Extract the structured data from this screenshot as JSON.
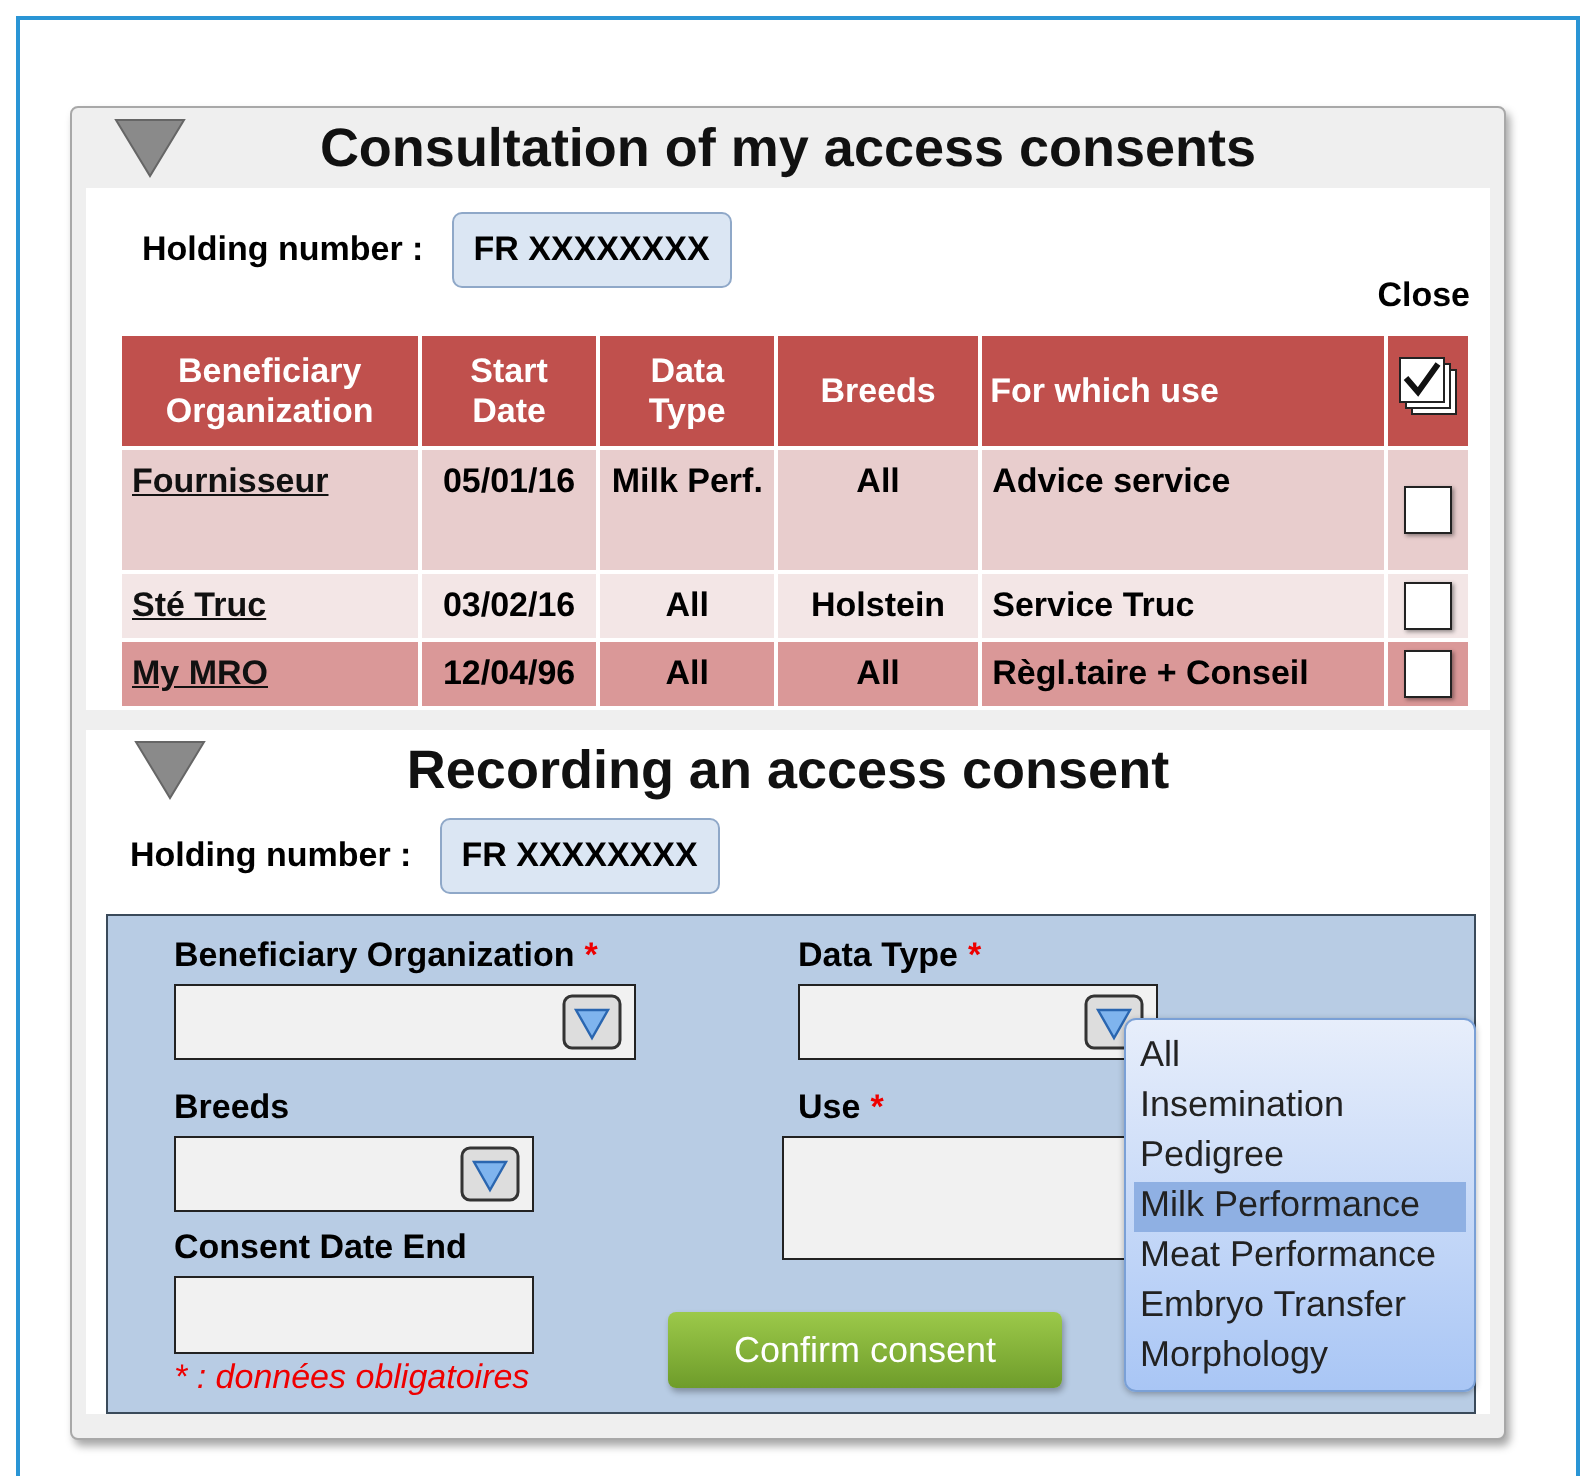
{
  "consultation": {
    "title": "Consultation of my access consents",
    "holding_label": "Holding number :",
    "holding_value": "FR XXXXXXXX",
    "close_label": "Close",
    "table": {
      "columns": [
        "Beneficiary Organization",
        "Start Date",
        "Data Type",
        "Breeds",
        "For which use"
      ],
      "select_all_checked": true,
      "rows": [
        {
          "cells": [
            "Fournisseur",
            "05/01/16",
            "Milk Perf.",
            "All",
            "Advice service"
          ],
          "color": "#e8cdcd",
          "checked": false
        },
        {
          "cells": [
            "Sté Truc",
            "03/02/16",
            "All",
            "Holstein",
            "Service Truc"
          ],
          "color": "#f3e6e6",
          "checked": false
        },
        {
          "cells": [
            "My MRO",
            "12/04/96",
            "All",
            "All",
            "Règl.taire + Conseil"
          ],
          "color": "#da9898",
          "checked": false
        }
      ]
    }
  },
  "recording": {
    "title": "Recording an access consent",
    "holding_label": "Holding number :",
    "holding_value": "FR XXXXXXXX",
    "fields": {
      "organization": {
        "label": "Beneficiary Organization",
        "required_mark": "*"
      },
      "data_type": {
        "label": "Data Type",
        "required_mark": "*"
      },
      "breeds": {
        "label": "Breeds"
      },
      "use": {
        "label": "Use",
        "required_mark": "*"
      },
      "end_date": {
        "label": "Consent Date End"
      }
    },
    "required_note": "* : données obligatoires",
    "confirm_button": "Confirm  consent",
    "data_type_options": [
      {
        "label": "All",
        "selected": false
      },
      {
        "label": "Insemination",
        "selected": false
      },
      {
        "label": "Pedigree",
        "selected": false
      },
      {
        "label": "Milk Performance",
        "selected": true
      },
      {
        "label": "Meat Performance",
        "selected": false
      },
      {
        "label": "Embryo Transfer",
        "selected": false
      },
      {
        "label": "Morphology",
        "selected": false
      }
    ]
  }
}
